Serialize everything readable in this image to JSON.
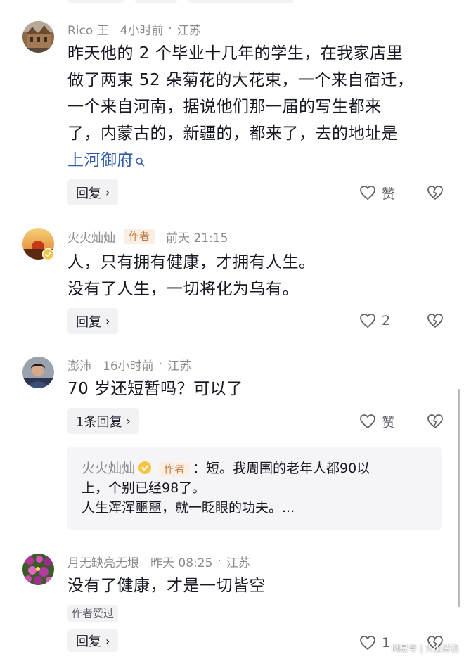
{
  "comments": [
    {
      "username": "Rico 王",
      "time": "4小时前",
      "location": "江苏",
      "body_lines": [
        "昨天他的 2 个毕业十几年的学生，在我家店里",
        "做了两束 52 朵菊花的大花束，一个来自宿迁，",
        "一个来自河南，据说他们那一届的写生都来",
        "了，内蒙古的，新疆的，都来了，去的地址是"
      ],
      "link_text": "上河御府",
      "reply_label": "回复",
      "like_label": "赞"
    },
    {
      "username": "火火灿灿",
      "author_tag": "作者",
      "time": "前天 21:15",
      "body_lines": [
        "人，只有拥有健康，才拥有人生。",
        "没有了人生，一切将化为乌有。"
      ],
      "reply_label": "回复",
      "like_count": "2"
    },
    {
      "username": "澎沛",
      "time": "16小时前",
      "location": "江苏",
      "body_lines": [
        "70 岁还短暂吗？可以了"
      ],
      "reply_label": "1条回复",
      "like_label": "赞",
      "reply": {
        "username": "火火灿灿",
        "author_tag": "作者",
        "lines": [
          "：短。我周围的老年人都90以",
          "上，个别已经98了。",
          "人生浑浑噩噩，就一眨眼的功夫。..."
        ]
      }
    },
    {
      "username": "月无缺亮无垠",
      "time": "昨天 08:25",
      "location": "江苏",
      "body_lines": [
        "没有了健康，才是一切皆空"
      ],
      "liked_by_author": "作者赞过",
      "reply_label": "回复",
      "like_count": "1"
    }
  ],
  "meta_separator": "·",
  "watermark": "网易号 | 火山诗话",
  "colors": {
    "meta_gray": "#8a8b91",
    "link_blue": "#2f5da8",
    "author_tag_bg": "#fbeee3",
    "author_tag_text": "#c07a46",
    "pill_bg": "#f2f2f4",
    "reply_card_bg": "#f5f5f7"
  },
  "icons": [
    "heart-outline-icon",
    "broken-heart-icon",
    "search-icon",
    "chevron-right-icon",
    "verified-badge-icon"
  ]
}
